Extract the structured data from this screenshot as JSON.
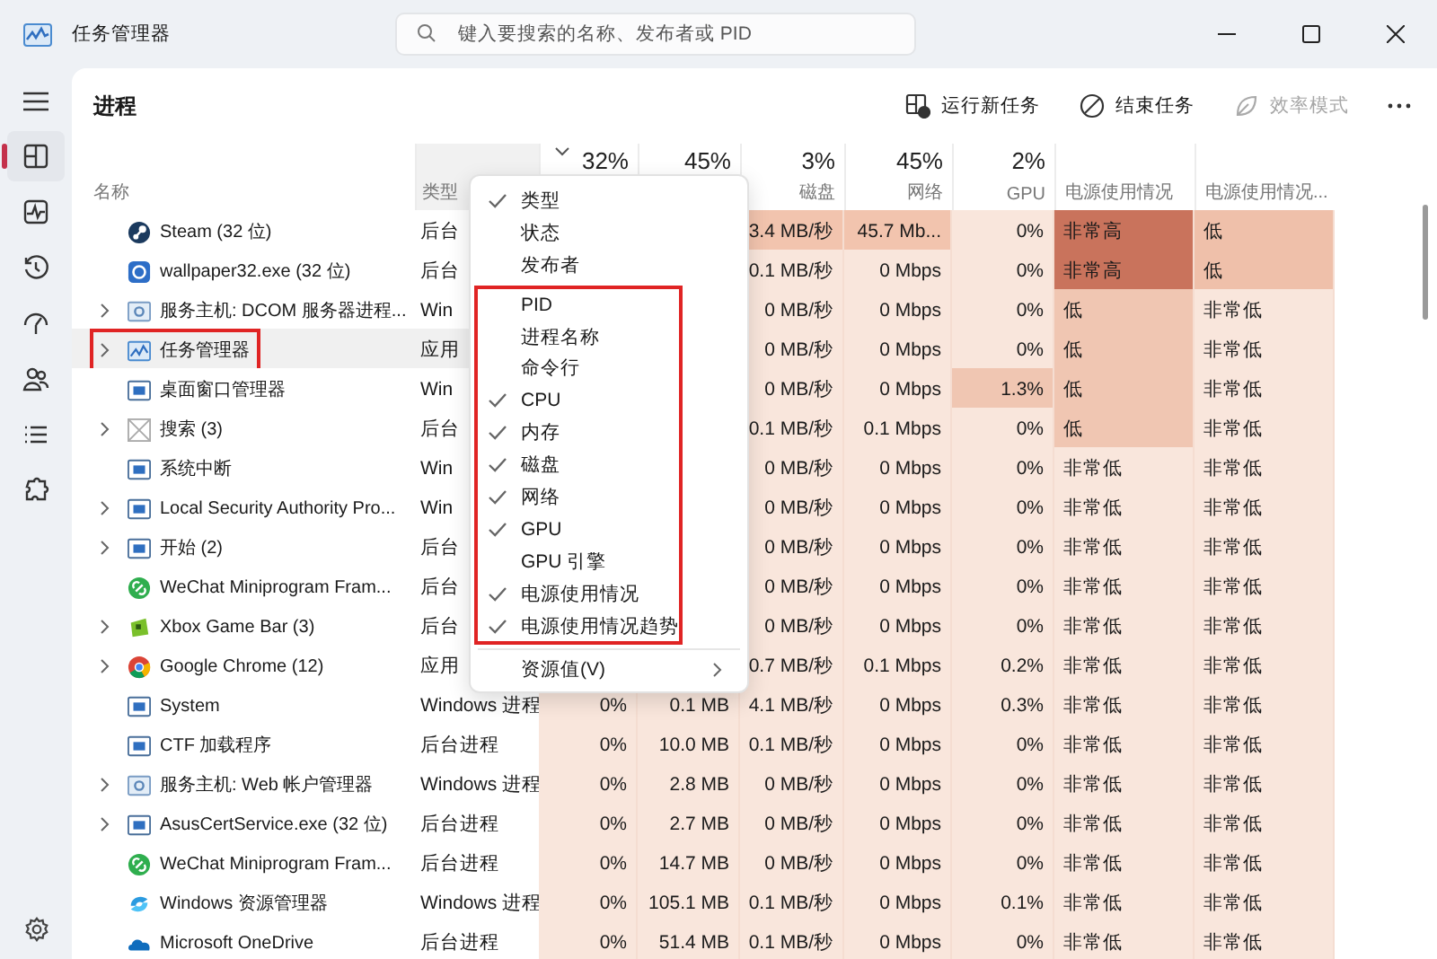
{
  "window": {
    "title": "任务管理器"
  },
  "search": {
    "placeholder": "键入要搜索的名称、发布者或 PID"
  },
  "rail": {
    "items": [
      {
        "kind": "processes",
        "selected": true
      },
      {
        "kind": "performance",
        "selected": false
      },
      {
        "kind": "history",
        "selected": false
      },
      {
        "kind": "startup",
        "selected": false
      },
      {
        "kind": "users",
        "selected": false
      },
      {
        "kind": "details",
        "selected": false
      },
      {
        "kind": "services",
        "selected": false
      }
    ]
  },
  "toolbar": {
    "title": "进程",
    "buttons": [
      {
        "kind": "run",
        "label": "运行新任务",
        "disabled": false
      },
      {
        "kind": "end",
        "label": "结束任务",
        "disabled": false
      },
      {
        "kind": "efficiency",
        "label": "效率模式",
        "disabled": true
      }
    ]
  },
  "table": {
    "columns": [
      {
        "label": "名称",
        "sorted": false
      },
      {
        "label": "类型",
        "sorted": false
      },
      {
        "percent": "32%",
        "sorted": true
      },
      {
        "percent": "45%",
        "sorted": false
      },
      {
        "percent": "3%",
        "label": "磁盘",
        "sorted": false
      },
      {
        "percent": "45%",
        "label": "网络",
        "sorted": false
      },
      {
        "percent": "2%",
        "label": "GPU",
        "sorted": false
      },
      {
        "label": "电源使用情况",
        "sorted": false
      },
      {
        "label": "电源使用情况...",
        "sorted": false
      }
    ],
    "rows": [
      {
        "kind": "steam",
        "name": "Steam (32 位)",
        "expandable": false,
        "selected": false,
        "type": "后台",
        "usage": [
          {
            "text": "3.4 MB/秒",
            "color": "#f2c4ae"
          },
          {
            "text": "45.7 Mb...",
            "color": "#f2c4ae"
          },
          {
            "text": "0%"
          },
          {
            "text": "非常高",
            "color": "#c9735c"
          },
          {
            "text": "低",
            "color": "#efc0aa"
          }
        ]
      },
      {
        "kind": "wallpaper",
        "name": "wallpaper32.exe (32 位)",
        "expandable": false,
        "selected": false,
        "type": "后台",
        "usage": [
          {
            "text": "0.1 MB/秒"
          },
          {
            "text": "0 Mbps"
          },
          {
            "text": "0%"
          },
          {
            "text": "非常高",
            "color": "#c9735c"
          },
          {
            "text": "低",
            "color": "#efc0aa"
          }
        ]
      },
      {
        "kind": "service",
        "name": "服务主机: DCOM 服务器进程...",
        "expandable": true,
        "selected": false,
        "type": "Win",
        "usage": [
          {
            "text": "0 MB/秒"
          },
          {
            "text": "0 Mbps"
          },
          {
            "text": "0%"
          },
          {
            "text": "低",
            "color": "#f0c6b2"
          },
          {
            "text": "非常低"
          }
        ]
      },
      {
        "kind": "taskmgr",
        "name": "任务管理器",
        "expandable": true,
        "selected": true,
        "highlight": true,
        "type": "应用",
        "usage": [
          {
            "text": "0 MB/秒"
          },
          {
            "text": "0 Mbps"
          },
          {
            "text": "0%"
          },
          {
            "text": "低",
            "color": "#f0c6b2"
          },
          {
            "text": "非常低"
          }
        ]
      },
      {
        "kind": "window",
        "name": "桌面窗口管理器",
        "expandable": false,
        "selected": false,
        "type": "Win",
        "usage": [
          {
            "text": "0 MB/秒"
          },
          {
            "text": "0 Mbps"
          },
          {
            "text": "1.3%",
            "color": "#f0c6b2"
          },
          {
            "text": "低",
            "color": "#f0c6b2"
          },
          {
            "text": "非常低"
          }
        ]
      },
      {
        "kind": "search",
        "name": "搜索 (3)",
        "expandable": true,
        "selected": false,
        "type": "后台",
        "usage": [
          {
            "text": "0.1 MB/秒"
          },
          {
            "text": "0.1 Mbps"
          },
          {
            "text": "0%"
          },
          {
            "text": "低",
            "color": "#f0c6b2"
          },
          {
            "text": "非常低"
          }
        ]
      },
      {
        "kind": "window",
        "name": "系统中断",
        "expandable": false,
        "selected": false,
        "type": "Win",
        "usage": [
          {
            "text": "0 MB/秒"
          },
          {
            "text": "0 Mbps"
          },
          {
            "text": "0%"
          },
          {
            "text": "非常低"
          },
          {
            "text": "非常低"
          }
        ]
      },
      {
        "kind": "window",
        "name": "Local Security Authority Pro...",
        "expandable": true,
        "selected": false,
        "type": "Win",
        "usage": [
          {
            "text": "0 MB/秒"
          },
          {
            "text": "0 Mbps"
          },
          {
            "text": "0%"
          },
          {
            "text": "非常低"
          },
          {
            "text": "非常低"
          }
        ]
      },
      {
        "kind": "window",
        "name": "开始 (2)",
        "expandable": true,
        "selected": false,
        "type": "后台",
        "usage": [
          {
            "text": "0 MB/秒"
          },
          {
            "text": "0 Mbps"
          },
          {
            "text": "0%"
          },
          {
            "text": "非常低"
          },
          {
            "text": "非常低"
          }
        ]
      },
      {
        "kind": "wechat",
        "name": "WeChat Miniprogram Fram...",
        "expandable": false,
        "selected": false,
        "type": "后台",
        "usage": [
          {
            "text": "0 MB/秒"
          },
          {
            "text": "0 Mbps"
          },
          {
            "text": "0%"
          },
          {
            "text": "非常低"
          },
          {
            "text": "非常低"
          }
        ]
      },
      {
        "kind": "xbox",
        "name": "Xbox Game Bar (3)",
        "expandable": true,
        "selected": false,
        "type": "后台",
        "usage": [
          {
            "text": "0 MB/秒"
          },
          {
            "text": "0 Mbps"
          },
          {
            "text": "0%"
          },
          {
            "text": "非常低"
          },
          {
            "text": "非常低"
          }
        ]
      },
      {
        "kind": "chrome",
        "name": "Google Chrome (12)",
        "expandable": true,
        "selected": false,
        "type": "应用",
        "usage": [
          {
            "text": "0.7 MB/秒"
          },
          {
            "text": "0.1 Mbps"
          },
          {
            "text": "0.2%"
          },
          {
            "text": "非常低"
          },
          {
            "text": "非常低"
          }
        ]
      },
      {
        "kind": "window",
        "name": "System",
        "expandable": false,
        "selected": false,
        "type": "Windows 进程",
        "usage": [
          {
            "text": "0%"
          },
          {
            "text": "0.1 MB"
          },
          {
            "text": "4.1 MB/秒"
          },
          {
            "text": "0 Mbps"
          },
          {
            "text": "0.3%"
          },
          {
            "text": "非常低"
          },
          {
            "text": "非常低"
          }
        ]
      },
      {
        "kind": "window",
        "name": "CTF 加载程序",
        "expandable": false,
        "selected": false,
        "type": "后台进程",
        "usage": [
          {
            "text": "0%"
          },
          {
            "text": "10.0 MB"
          },
          {
            "text": "0.1 MB/秒"
          },
          {
            "text": "0 Mbps"
          },
          {
            "text": "0%"
          },
          {
            "text": "非常低"
          },
          {
            "text": "非常低"
          }
        ]
      },
      {
        "kind": "service",
        "name": "服务主机: Web 帐户管理器",
        "expandable": true,
        "selected": false,
        "type": "Windows 进程",
        "usage": [
          {
            "text": "0%"
          },
          {
            "text": "2.8 MB"
          },
          {
            "text": "0 MB/秒"
          },
          {
            "text": "0 Mbps"
          },
          {
            "text": "0%"
          },
          {
            "text": "非常低"
          },
          {
            "text": "非常低"
          }
        ]
      },
      {
        "kind": "window",
        "name": "AsusCertService.exe (32 位)",
        "expandable": true,
        "selected": false,
        "type": "后台进程",
        "usage": [
          {
            "text": "0%"
          },
          {
            "text": "2.7 MB"
          },
          {
            "text": "0 MB/秒"
          },
          {
            "text": "0 Mbps"
          },
          {
            "text": "0%"
          },
          {
            "text": "非常低"
          },
          {
            "text": "非常低"
          }
        ]
      },
      {
        "kind": "wechat",
        "name": "WeChat Miniprogram Fram...",
        "expandable": false,
        "selected": false,
        "type": "后台进程",
        "usage": [
          {
            "text": "0%"
          },
          {
            "text": "14.7 MB"
          },
          {
            "text": "0 MB/秒"
          },
          {
            "text": "0 Mbps"
          },
          {
            "text": "0%"
          },
          {
            "text": "非常低"
          },
          {
            "text": "非常低"
          }
        ]
      },
      {
        "kind": "explorer",
        "name": "Windows 资源管理器",
        "expandable": false,
        "selected": false,
        "type": "Windows 进程",
        "usage": [
          {
            "text": "0%"
          },
          {
            "text": "105.1 MB"
          },
          {
            "text": "0.1 MB/秒"
          },
          {
            "text": "0 Mbps"
          },
          {
            "text": "0.1%"
          },
          {
            "text": "非常低"
          },
          {
            "text": "非常低"
          }
        ]
      },
      {
        "kind": "onedrive",
        "name": "Microsoft OneDrive",
        "expandable": false,
        "selected": false,
        "type": "后台进程",
        "usage": [
          {
            "text": "0%"
          },
          {
            "text": "51.4 MB"
          },
          {
            "text": "0.1 MB/秒"
          },
          {
            "text": "0 Mbps"
          },
          {
            "text": "0%"
          },
          {
            "text": "非常低"
          },
          {
            "text": "非常低"
          }
        ]
      }
    ]
  },
  "column_menu": {
    "groups": [
      {
        "highlight": false,
        "items": [
          {
            "label": "类型",
            "checked": true
          },
          {
            "label": "状态",
            "checked": false
          },
          {
            "label": "发布者",
            "checked": false
          }
        ]
      },
      {
        "highlight": true,
        "items": [
          {
            "label": "PID",
            "checked": false
          },
          {
            "label": "进程名称",
            "checked": false
          },
          {
            "label": "命令行",
            "checked": false
          },
          {
            "label": "CPU",
            "checked": true
          },
          {
            "label": "内存",
            "checked": true
          },
          {
            "label": "磁盘",
            "checked": true
          },
          {
            "label": "网络",
            "checked": true
          },
          {
            "label": "GPU",
            "checked": true
          },
          {
            "label": "GPU 引擎",
            "checked": false
          },
          {
            "label": "电源使用情况",
            "checked": true
          },
          {
            "label": "电源使用情况趋势",
            "checked": true
          }
        ]
      }
    ],
    "submenu": {
      "label": "资源值(V)"
    }
  }
}
